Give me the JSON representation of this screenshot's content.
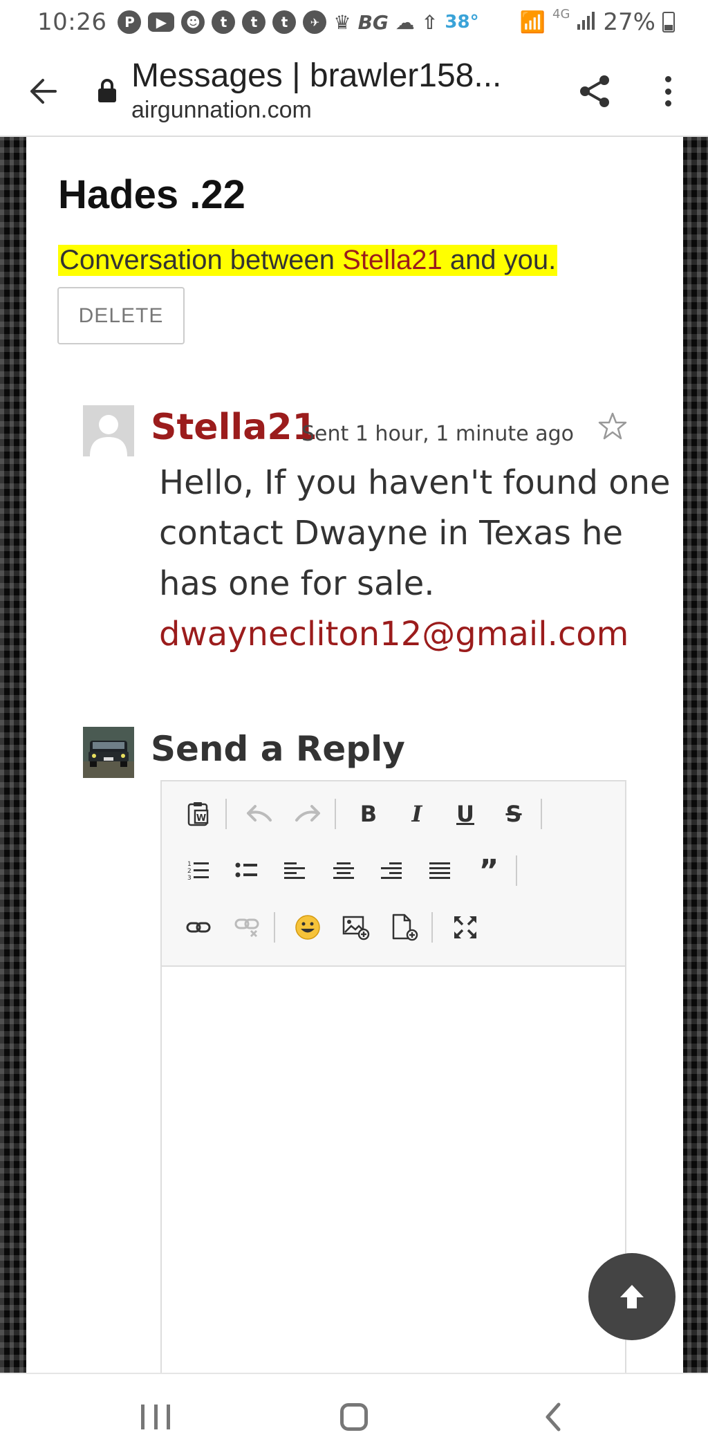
{
  "status_bar": {
    "time": "10:26",
    "temperature": "38°",
    "network": "4G",
    "battery": "27%",
    "icons": [
      "pinterest-icon",
      "youtube-icon",
      "reddit-icon",
      "tumblr-icon",
      "tumblr-icon",
      "tumblr-icon",
      "nfl-icon",
      "trophy-icon",
      "bg-text-icon",
      "cloud-icon",
      "upload-icon",
      "wifi-icon",
      "signal-icon",
      "battery-icon"
    ],
    "bg_label": "BG"
  },
  "browser": {
    "page_title": "Messages | brawler158...",
    "domain": "airgunnation.com"
  },
  "conversation": {
    "title": "Hades .22",
    "intro_prefix": "Conversation between ",
    "intro_user": "Stella21",
    "intro_suffix": " and you.",
    "delete_label": "DELETE",
    "highlight_color": "#ffff00"
  },
  "message": {
    "author": "Stella21",
    "time": "Sent 1 hour, 1 minute ago",
    "body": "Hello, If you haven't found one contact Dwayne in Texas he has one for sale.",
    "email": "dwaynecliton12@gmail.com",
    "author_color": "#9b1c1c"
  },
  "reply": {
    "title": "Send a Reply",
    "toolbar": {
      "row1": [
        "paste-word-icon",
        "undo-icon",
        "redo-icon",
        "bold-icon",
        "italic-icon",
        "underline-icon",
        "strikethrough-icon"
      ],
      "row2": [
        "ordered-list-icon",
        "unordered-list-icon",
        "align-left-icon",
        "align-center-icon",
        "align-right-icon",
        "align-justify-icon",
        "blockquote-icon"
      ],
      "row3": [
        "link-icon",
        "unlink-icon",
        "emoji-icon",
        "insert-image-icon",
        "insert-file-icon",
        "fullscreen-icon"
      ]
    },
    "body_value": ""
  }
}
